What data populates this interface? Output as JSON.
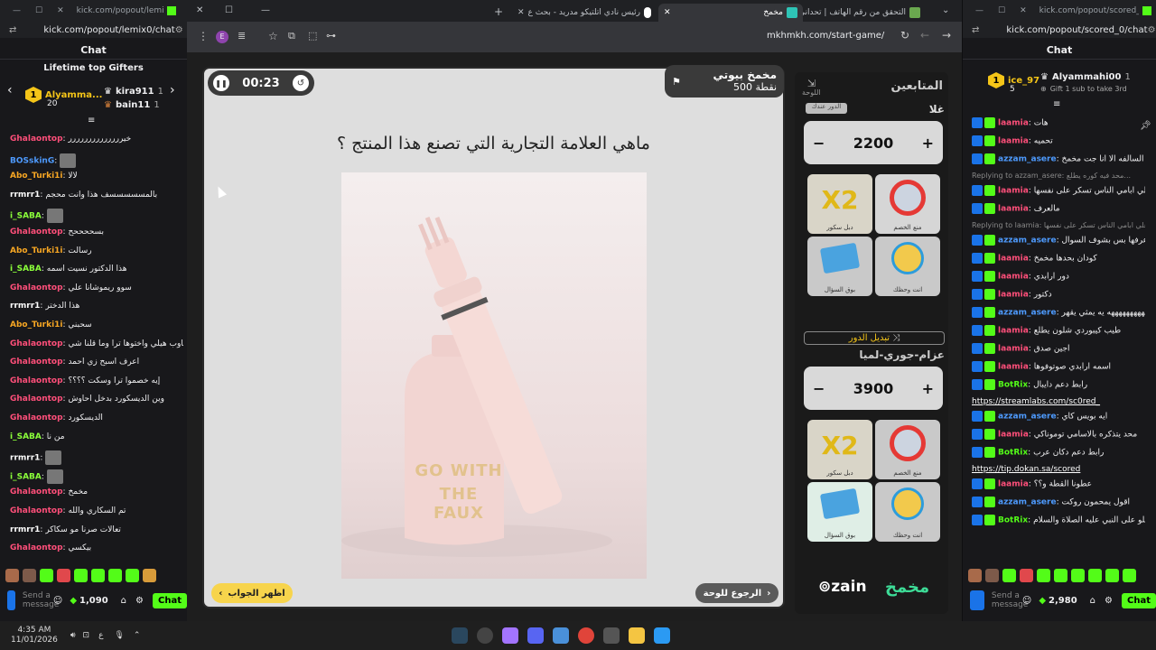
{
  "left_popout": {
    "url": "kick.com/popout/lemix0/chat",
    "title": "kick.com/popout/lemix0/...",
    "header": "Chat",
    "gifters_title": "Lifetime top Gifters",
    "gifters": [
      {
        "name": "Alyamma...",
        "count": "20"
      },
      {
        "name": "kira911",
        "count": "1"
      },
      {
        "name": "bain11",
        "count": "1"
      }
    ],
    "messages": [
      {
        "user": "Ghalaontop",
        "color": "#ff4f7a",
        "text": "خيرررررررررررررر"
      },
      {
        "user": "BOSskinG",
        "color": "#4e9bff",
        "text": ""
      },
      {
        "user": "Abo_Turki1i",
        "color": "#f6a623",
        "text": "لالا"
      },
      {
        "user": "rrmrr1",
        "color": "#ffffff",
        "text": "بالمسسسسسف هذا وانت محجم"
      },
      {
        "user": "i_SABA",
        "color": "#8bff3a",
        "text": ""
      },
      {
        "user": "Ghalaontop",
        "color": "#ff4f7a",
        "text": "بسححححح"
      },
      {
        "user": "Abo_Turki1i",
        "color": "#f6a623",
        "text": "رسالت"
      },
      {
        "user": "i_SABA",
        "color": "#8bff3a",
        "text": "هذا الدكتور نسيت اسمه"
      },
      {
        "user": "Ghalaontop",
        "color": "#ff4f7a",
        "text": "سوو ريموشانا علي"
      },
      {
        "user": "rrmrr1",
        "color": "#ffffff",
        "text": "هذا الدختر"
      },
      {
        "user": "Abo_Turki1i",
        "color": "#f6a623",
        "text": "سحبني"
      },
      {
        "user": "Ghalaontop",
        "color": "#ff4f7a",
        "text": "علي جاوب هيلي واختوها ترا وما قلنا شي"
      },
      {
        "user": "Ghalaontop",
        "color": "#ff4f7a",
        "text": "اعرف اسبح زي احمد"
      },
      {
        "user": "Ghalaontop",
        "color": "#ff4f7a",
        "text": "إيه خصموا ترا وسكت ؟؟؟؟"
      },
      {
        "user": "Ghalaontop",
        "color": "#ff4f7a",
        "text": "وين الديسكورد بدخل احاوش"
      },
      {
        "user": "Ghalaontop",
        "color": "#ff4f7a",
        "text": "الديسكورد"
      },
      {
        "user": "i_SABA",
        "color": "#8bff3a",
        "text": "من نا"
      },
      {
        "user": "rrmrr1",
        "color": "#ffffff",
        "text": ""
      },
      {
        "user": "i_SABA",
        "color": "#8bff3a",
        "text": ""
      },
      {
        "user": "Ghalaontop",
        "color": "#ff4f7a",
        "text": "مخمخ"
      },
      {
        "user": "Ghalaontop",
        "color": "#ff4f7a",
        "text": "تم السكاري والله"
      },
      {
        "user": "rrmrr1",
        "color": "#ffffff",
        "text": "تعالات صرنا مو سكاكر"
      },
      {
        "user": "Ghalaontop",
        "color": "#ff4f7a",
        "text": "بيكسي"
      }
    ],
    "send_placeholder": "Send a message",
    "points": "1,090",
    "chat_btn": "Chat"
  },
  "browser": {
    "tabs": [
      {
        "label": "التحقق من رقم الهاتف | تحداني"
      },
      {
        "label": "مخمخ"
      },
      {
        "label": "رئيس نادي اتلتيكو مدريد - بحث ع"
      }
    ],
    "url": "mkhmkh.com/start-game/",
    "ext_badge": "E"
  },
  "game": {
    "timer": "00:23",
    "team_points_title": "مخمخ بيوتي",
    "team_points_value": "500 نقطة",
    "question": "ماهي العلامة التجارية التي تصنع هذا المنتج ؟",
    "product_text_1": "GO WITH",
    "product_text_2": "THE FAUX",
    "show_answer": "اظهر الجواب",
    "back_to_board": "الرجوع للوحة",
    "followers_title": "المتابعين",
    "board_label": "اللوحة",
    "team1_name": "غلا",
    "team1_turn": "الدور عندك",
    "team1_score": "2200",
    "team2_name": "عزام-جوري-لميا",
    "switch_turn": "تبديل الدور",
    "team2_score": "3900",
    "powerups": [
      {
        "big": "X2",
        "label": "دبل سكور"
      },
      {
        "big": "",
        "label": "منع الخصم"
      },
      {
        "big": "",
        "label": "بوق السؤال"
      },
      {
        "big": "",
        "label": "انت وحظك"
      }
    ],
    "sponsor": "zain",
    "brand": "مخمخ"
  },
  "right_popout": {
    "url": "kick.com/popout/scored_0/chat",
    "title": "kick.com/popout/scored_0/...",
    "header": "Chat",
    "top_user": "ice_97",
    "top_user_count": "5",
    "gifter": "Alyammahi00",
    "gifter_count": "1",
    "gift_note": "Gift 1 sub to take 3rd",
    "messages": [
      {
        "user": "laamia",
        "color": "#ff4f7a",
        "text": "هات"
      },
      {
        "user": "laamia",
        "color": "#ff4f7a",
        "text": "تحميه"
      },
      {
        "user": "azzam_asere",
        "color": "#4e9bff",
        "text": "محد فيه كوره يطلع برا السالفه الا انا جت مخمخ"
      },
      {
        "user": "reply",
        "color": "#888888",
        "text": "Replying to azzam_asere: محد فيه كوره يطلع..."
      },
      {
        "user": "laamia",
        "color": "#ff4f7a",
        "text": "علي ابامي الناس تسكر على نفسها"
      },
      {
        "user": "laamia",
        "color": "#ff4f7a",
        "text": "مالعرف"
      },
      {
        "user": "reply",
        "color": "#888888",
        "text": "Replying to laamia: علي ابامي الناس تسكر على نفسها"
      },
      {
        "user": "azzam_asere",
        "color": "#4e9bff",
        "text": "انا قلت الا انا جت ما قلت اعرفها بس بشوف السوال"
      },
      {
        "user": "laamia",
        "color": "#ff4f7a",
        "text": "كودان بحدها مخمخ"
      },
      {
        "user": "laamia",
        "color": "#ff4f7a",
        "text": "دور ارابدي"
      },
      {
        "user": "laamia",
        "color": "#ff4f7a",
        "text": "دكتور"
      },
      {
        "user": "azzam_asere",
        "color": "#4e9bff",
        "text": "هههههههههههه يه يمثي يقهر"
      },
      {
        "user": "laamia",
        "color": "#ff4f7a",
        "text": "طيب كيبوردي شلون يطلع"
      },
      {
        "user": "laamia",
        "color": "#ff4f7a",
        "text": "اجين صدق"
      },
      {
        "user": "laamia",
        "color": "#ff4f7a",
        "text": "اسمه ارابدي صوتوفوها"
      },
      {
        "user": "BotRix",
        "color": "#53fc18",
        "text": "رابط دعم دايبال"
      },
      {
        "user": "link",
        "color": "#ffffff",
        "text": "https://streamlabs.com/sc0red_"
      },
      {
        "user": "azzam_asere",
        "color": "#4e9bff",
        "text": "ايه بويس كاي"
      },
      {
        "user": "laamia",
        "color": "#ff4f7a",
        "text": "محد يتذكره بالاسامي توموناكي"
      },
      {
        "user": "BotRix",
        "color": "#53fc18",
        "text": "رابط دعم دكان عرب"
      },
      {
        "user": "link",
        "color": "#ffffff",
        "text": "https://tip.dokan.sa/scored"
      },
      {
        "user": "laamia",
        "color": "#ff4f7a",
        "text": "عطونا القطة و؟؟"
      },
      {
        "user": "azzam_asere",
        "color": "#4e9bff",
        "text": "اقول يمحمون روكت"
      },
      {
        "user": "BotRix",
        "color": "#53fc18",
        "text": "صلو على النبي عليه الصلاة والسلام"
      }
    ],
    "send_placeholder": "Send a message",
    "points": "2,980",
    "chat_btn": "Chat"
  },
  "taskbar": {
    "time": "4:35 AM",
    "date": "11/01/2026",
    "lang": "ع"
  }
}
